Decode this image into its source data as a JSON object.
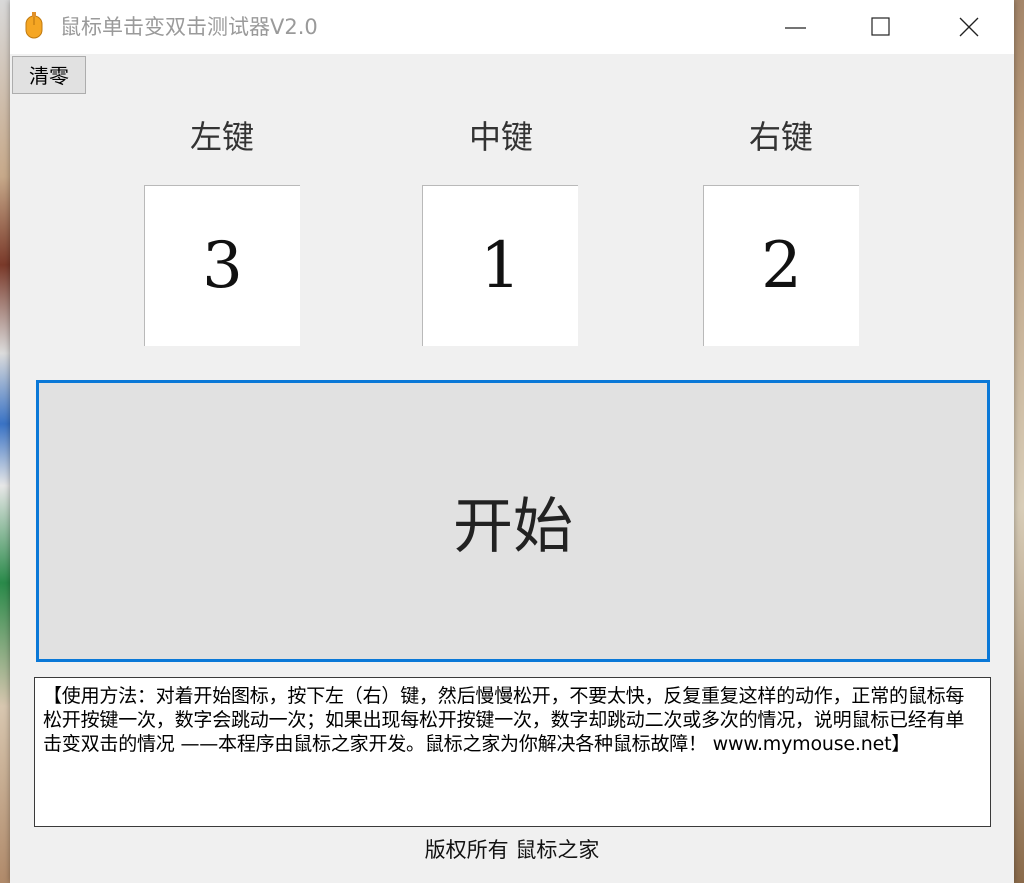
{
  "window": {
    "title": "鼠标单击变双击测试器V2.0"
  },
  "toolbar": {
    "clear_label": "清零"
  },
  "keys": [
    {
      "label": "左键",
      "count": "3"
    },
    {
      "label": "中键",
      "count": "1"
    },
    {
      "label": "右键",
      "count": "2"
    }
  ],
  "start_button": {
    "label": "开始"
  },
  "instructions": {
    "text": "【使用方法：对着开始图标，按下左（右）键，然后慢慢松开，不要太快，反复重复这样的动作，正常的鼠标每松开按键一次，数字会跳动一次；如果出现每松开按键一次，数字却跳动二次或多次的情况，说明鼠标已经有单击变双击的情况 ——本程序由鼠标之家开发。鼠标之家为你解决各种鼠标故障！ www.mymouse.net】"
  },
  "footer": {
    "text": "版权所有 鼠标之家"
  },
  "icons": {
    "app": "mouse-icon",
    "minimize": "minimize-icon",
    "maximize": "maximize-icon",
    "close": "close-icon"
  },
  "colors": {
    "accent_border": "#0a78d7",
    "app_icon": "#f5a623"
  }
}
